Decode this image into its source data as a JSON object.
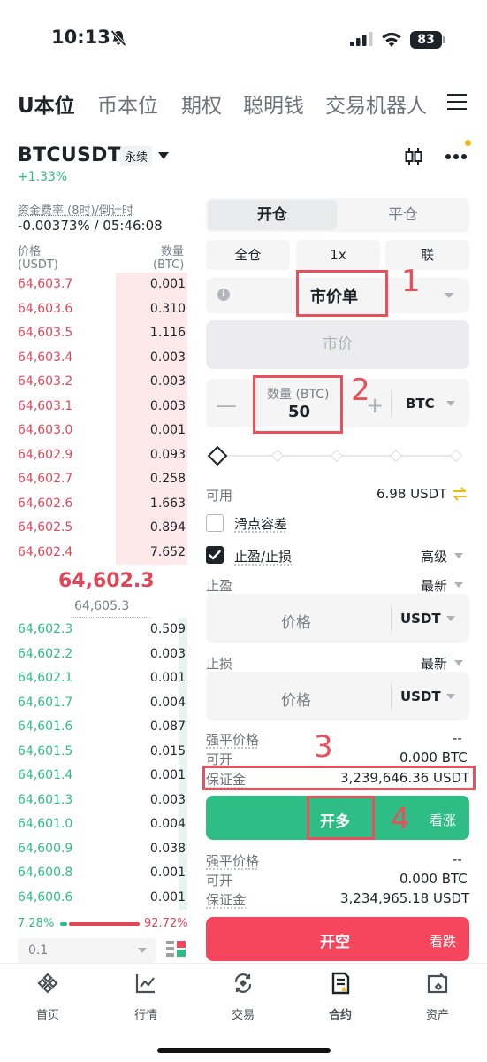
{
  "status_bar": {
    "time": "10:13",
    "battery": "83"
  },
  "top_tabs": [
    "U本位",
    "币本位",
    "期权",
    "聪明钱",
    "交易机器人"
  ],
  "symbol": {
    "name": "BTCUSDT",
    "tag": "永续",
    "change": "+1.33%"
  },
  "funding": {
    "label": "资金费率 (8时)/倒计时",
    "value": "-0.00373% / 05:46:08"
  },
  "orderbook": {
    "price_label": "价格",
    "price_unit": "(USDT)",
    "qty_label": "数量",
    "qty_unit": "(BTC)",
    "asks": [
      {
        "price": "64,603.7",
        "qty": "0.001",
        "depth": 0.42
      },
      {
        "price": "64,603.6",
        "qty": "0.310",
        "depth": 0.42
      },
      {
        "price": "64,603.5",
        "qty": "1.116",
        "depth": 0.42
      },
      {
        "price": "64,603.4",
        "qty": "0.003",
        "depth": 0.42
      },
      {
        "price": "64,603.2",
        "qty": "0.003",
        "depth": 0.42
      },
      {
        "price": "64,603.1",
        "qty": "0.003",
        "depth": 0.42
      },
      {
        "price": "64,603.0",
        "qty": "0.001",
        "depth": 0.42
      },
      {
        "price": "64,602.9",
        "qty": "0.093",
        "depth": 0.42
      },
      {
        "price": "64,602.7",
        "qty": "0.258",
        "depth": 0.42
      },
      {
        "price": "64,602.6",
        "qty": "1.663",
        "depth": 0.42
      },
      {
        "price": "64,602.5",
        "qty": "0.894",
        "depth": 0.42
      },
      {
        "price": "64,602.4",
        "qty": "7.652",
        "depth": 0.42
      }
    ],
    "mid_price": "64,602.3",
    "mark_price": "64,605.3",
    "bids": [
      {
        "price": "64,602.3",
        "qty": "0.509",
        "depth": 0.05
      },
      {
        "price": "64,602.2",
        "qty": "0.003",
        "depth": 0.05
      },
      {
        "price": "64,602.1",
        "qty": "0.001",
        "depth": 0.05
      },
      {
        "price": "64,601.7",
        "qty": "0.004",
        "depth": 0.05
      },
      {
        "price": "64,601.6",
        "qty": "0.087",
        "depth": 0.05
      },
      {
        "price": "64,601.5",
        "qty": "0.015",
        "depth": 0.05
      },
      {
        "price": "64,601.4",
        "qty": "0.001",
        "depth": 0.05
      },
      {
        "price": "64,601.3",
        "qty": "0.003",
        "depth": 0.05
      },
      {
        "price": "64,601.0",
        "qty": "0.004",
        "depth": 0.05
      },
      {
        "price": "64,600.9",
        "qty": "0.038",
        "depth": 0.05
      },
      {
        "price": "64,600.8",
        "qty": "0.001",
        "depth": 0.05
      },
      {
        "price": "64,600.6",
        "qty": "0.001",
        "depth": 0.05
      }
    ],
    "bid_ratio": "7.28%",
    "ask_ratio": "92.72%",
    "depth_step": "0.1"
  },
  "order_form": {
    "open_tab": "开仓",
    "close_tab": "平仓",
    "margin_mode": "全仓",
    "leverage": "1x",
    "position_mode": "联",
    "info_icon": "i",
    "order_type": "市价单",
    "market_price_placeholder": "市价",
    "qty_label": "数量 (BTC)",
    "qty_value": "50",
    "qty_unit": "BTC",
    "minus": "—",
    "plus": "+",
    "available_label": "可用",
    "available_value": "6.98 USDT",
    "slippage_label": "滑点容差",
    "tpsl_label": "止盈/止损",
    "advanced_label": "高级",
    "take_profit_label": "止盈",
    "stop_loss_label": "止损",
    "latest_label": "最新",
    "price_placeholder": "价格",
    "price_unit": "USDT",
    "long": {
      "liq_label": "强平价格",
      "liq_value": "--",
      "max_label": "可开",
      "max_value": "0.000 BTC",
      "margin_label": "保证金",
      "margin_value": "3,239,646.36 USDT",
      "button": "开多",
      "side": "看涨"
    },
    "short": {
      "liq_label": "强平价格",
      "liq_value": "--",
      "max_label": "可开",
      "max_value": "0.000 BTC",
      "margin_label": "保证金",
      "margin_value": "3,234,965.18 USDT",
      "button": "开空",
      "side": "看跌"
    }
  },
  "annotations": [
    "1",
    "2",
    "3",
    "4"
  ],
  "bottom_nav": [
    "首页",
    "行情",
    "交易",
    "合约",
    "资产"
  ],
  "colors": {
    "green": "#2ebd85",
    "red": "#f6465d",
    "annotation": "#e8505b",
    "brand": "#f0b90b"
  }
}
